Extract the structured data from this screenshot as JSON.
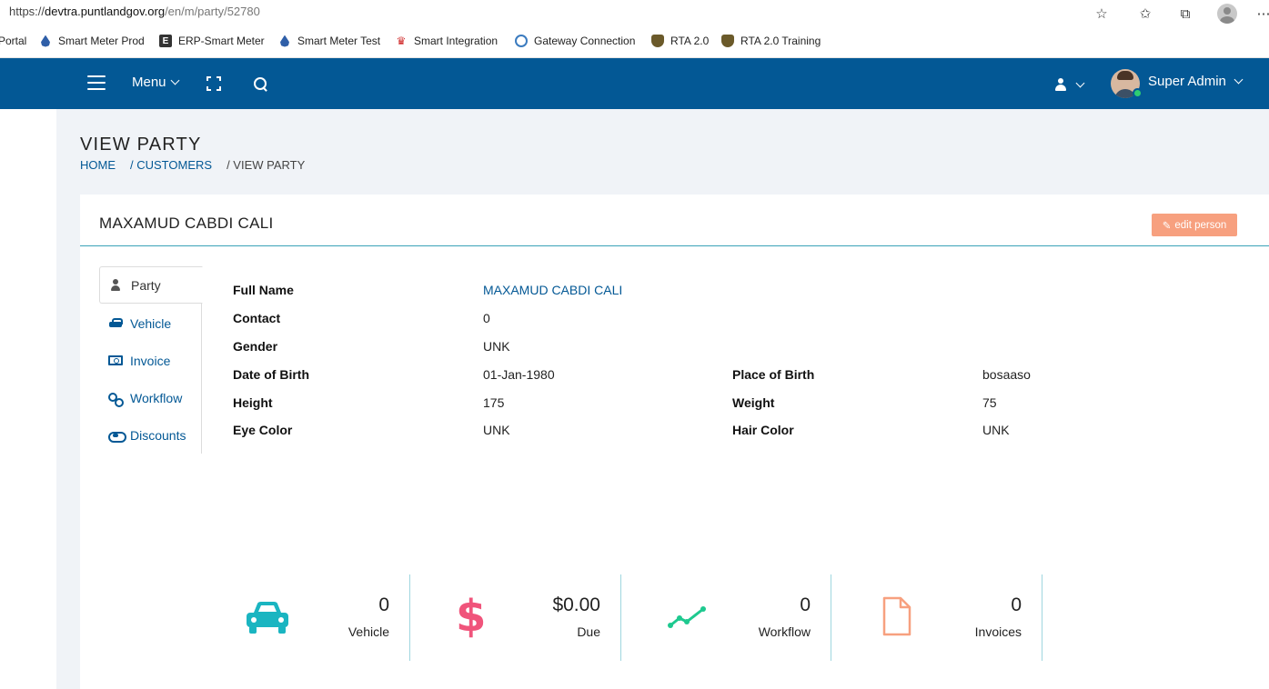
{
  "browser": {
    "url_scheme": "https://",
    "url_host": "devtra.puntlandgov.org",
    "url_path": "/en/m/party/52780"
  },
  "bookmarks": [
    {
      "label": "Portal",
      "icon": "none"
    },
    {
      "label": "Smart Meter Prod",
      "icon": "drop-icon"
    },
    {
      "label": "ERP-Smart Meter",
      "icon": "e-icon"
    },
    {
      "label": "Smart Meter Test",
      "icon": "drop-icon"
    },
    {
      "label": "Smart Integration",
      "icon": "red-crown-icon"
    },
    {
      "label": "Gateway Connection",
      "icon": "gateway-icon"
    },
    {
      "label": "RTA 2.0",
      "icon": "crest-icon"
    },
    {
      "label": "RTA 2.0 Training",
      "icon": "crest-icon"
    }
  ],
  "header": {
    "menu_label": "Menu",
    "user_name": "Super Admin",
    "bg_color": "#035895"
  },
  "page": {
    "title": "VIEW PARTY",
    "breadcrumb": [
      "HOME",
      "/ CUSTOMERS",
      "/ VIEW PARTY"
    ]
  },
  "party": {
    "name": "MAXAMUD CABDI CALI",
    "edit_label": "edit person",
    "tabs": [
      {
        "label": "Party",
        "icon": "user-icon"
      },
      {
        "label": "Vehicle",
        "icon": "car-icon"
      },
      {
        "label": "Invoice",
        "icon": "money-icon"
      },
      {
        "label": "Workflow",
        "icon": "workflow-icon"
      },
      {
        "label": "Discounts",
        "icon": "handshake-icon"
      }
    ],
    "details": {
      "full_name_label": "Full Name",
      "full_name": "MAXAMUD CABDI CALI",
      "contact_label": "Contact",
      "contact": "0",
      "gender_label": "Gender",
      "gender": "UNK",
      "dob_label": "Date of Birth",
      "dob": "01-Jan-1980",
      "pob_label": "Place of Birth",
      "pob": "bosaaso",
      "height_label": "Height",
      "height": "175",
      "weight_label": "Weight",
      "weight": "75",
      "eye_label": "Eye Color",
      "eye": "UNK",
      "hair_label": "Hair Color",
      "hair": "UNK"
    },
    "stats": [
      {
        "value": "0",
        "label": "Vehicle",
        "icon": "car-icon",
        "color": "#1ab5c1"
      },
      {
        "value": "$0.00",
        "label": "Due",
        "icon": "dollar-icon",
        "color": "#f0547b"
      },
      {
        "value": "0",
        "label": "Workflow",
        "icon": "trend-icon",
        "color": "#1ec98f"
      },
      {
        "value": "0",
        "label": "Invoices",
        "icon": "file-icon",
        "color": "#f7a07f"
      }
    ]
  }
}
